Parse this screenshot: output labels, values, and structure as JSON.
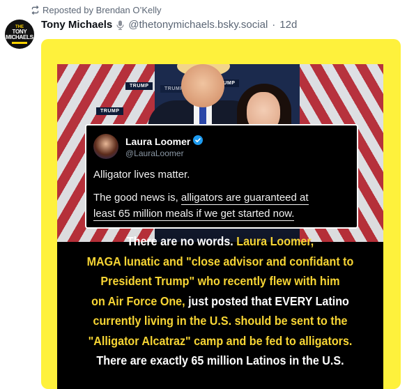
{
  "repost": {
    "label": "Reposted by Brendan O’Kelly"
  },
  "author": {
    "display_name": "Tony Michaels",
    "handle": "@thetonymichaels.bsky.social",
    "separator": "·",
    "time": "12d",
    "avatar_text": [
      "THE",
      "TONY",
      "MICHAELS"
    ]
  },
  "embedded_tweet": {
    "name": "Laura Loomer",
    "handle": "@LauraLoomer",
    "line1": "Alligator lives matter.",
    "line2_pre": "The good news is, ",
    "line2_ul": "alligators are guaranteed at",
    "line3_ul": "least 65 million meals if we get started now."
  },
  "photo_signs": [
    "TRUMP",
    "TRUMP",
    "TRUMP",
    "TRUMP"
  ],
  "caption": {
    "rows": [
      [
        {
          "t": "There are no words. ",
          "c": "white"
        },
        {
          "t": "Laura Loomer,",
          "c": "yellow"
        }
      ],
      [
        {
          "t": "MAGA lunatic and \"close advisor and confidant to",
          "c": "yellow"
        }
      ],
      [
        {
          "t": "President Trump\" who recently flew with him",
          "c": "yellow"
        }
      ],
      [
        {
          "t": "on Air Force One, ",
          "c": "yellow"
        },
        {
          "t": "just posted that EVERY Latino",
          "c": "white"
        }
      ],
      [
        {
          "t": "currently living in the U.S. should be sent to the",
          "c": "yellow"
        }
      ],
      [
        {
          "t": "\"Alligator Alcatraz\" camp and be fed to alligators.",
          "c": "yellow"
        }
      ],
      [
        {
          "t": "There are exactly 65 million Latinos in the U.S.",
          "c": "white"
        }
      ]
    ]
  },
  "colors": {
    "frame_bg": "#fef13c",
    "caption_yellow": "#f7d534",
    "muted_text": "#5b6675",
    "verified_blue": "#1d9bf0"
  }
}
